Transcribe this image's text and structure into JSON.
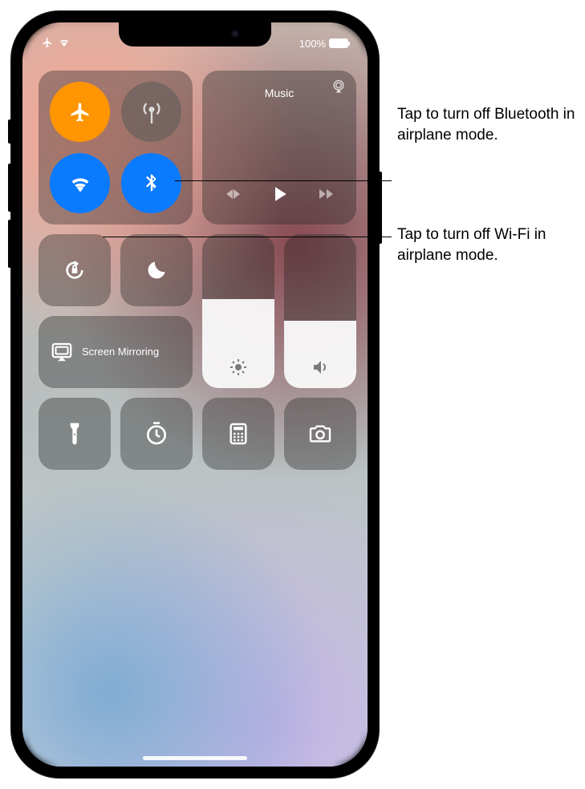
{
  "status": {
    "battery_pct": "100%"
  },
  "connectivity": {
    "airplane": true,
    "cellular": false,
    "wifi": true,
    "bluetooth": true
  },
  "music": {
    "title": "Music"
  },
  "screen_mirroring": {
    "label": "Screen Mirroring"
  },
  "sliders": {
    "brightness_pct": 58,
    "volume_pct": 44
  },
  "shortcuts": {
    "orientation_lock": "Orientation Lock",
    "dnd": "Do Not Disturb",
    "flashlight": "Flashlight",
    "timer": "Timer",
    "calculator": "Calculator",
    "camera": "Camera"
  },
  "callouts": {
    "bluetooth": "Tap to turn off Bluetooth in airplane mode.",
    "wifi": "Tap to turn off Wi‑Fi in airplane mode."
  }
}
